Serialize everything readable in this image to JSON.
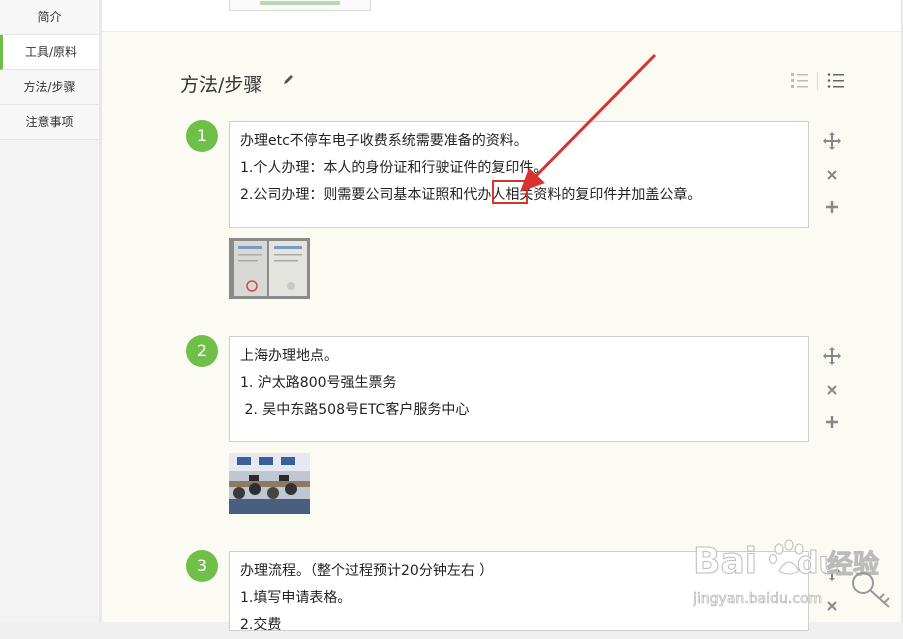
{
  "nav": {
    "items": [
      {
        "label": "简介",
        "active": false
      },
      {
        "label": "工具/原料",
        "active": true
      },
      {
        "label": "方法/步骤",
        "active": false
      },
      {
        "label": "注意事项",
        "active": false
      }
    ]
  },
  "section": {
    "title": "方法/步骤",
    "edit_icon": "pencil-icon",
    "view_icons": [
      "numbered-list-icon",
      "bullet-list-icon"
    ]
  },
  "steps": [
    {
      "number": "1",
      "lines": [
        "办理etc不停车电子收费系统需要准备的资料。",
        "1.个人办理：本人的身份证和行驶证件的复印件。",
        "2.公司办理：则需要公司基本证照和代办人相关资料的复印件并加盖公章。"
      ],
      "image": "document-photo"
    },
    {
      "number": "2",
      "lines": [
        "上海办理地点。",
        "1. 沪太路800号强生票务",
        " 2. 吴中东路508号ETC客户服务中心"
      ],
      "image": "service-center-photo"
    },
    {
      "number": "3",
      "lines": [
        "办理流程。（整个过程预计20分钟左右 ）",
        "1.填写申请表格。",
        "2.交费"
      ]
    }
  ],
  "actions": [
    "move-icon",
    "delete-icon",
    "add-icon"
  ],
  "colors": {
    "accent": "#6fbf49",
    "annotation": "#d8332e"
  },
  "watermark": {
    "brand": "Bai",
    "brand2": "du",
    "cn": "经验",
    "url": "jingyan.baidu.com"
  }
}
